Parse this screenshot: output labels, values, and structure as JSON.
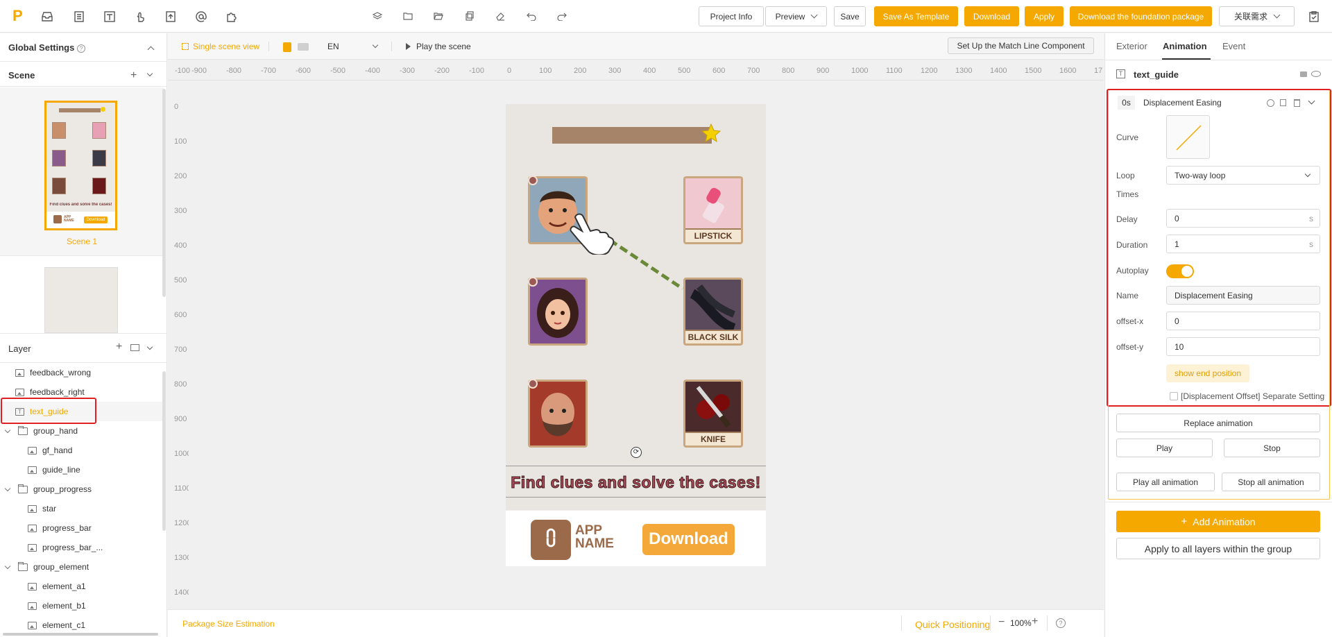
{
  "topbar": {
    "logo": "P",
    "project_info": "Project Info",
    "preview": "Preview",
    "save": "Save",
    "save_template": "Save As Template",
    "download": "Download",
    "apply": "Apply",
    "download_foundation": "Download the foundation package",
    "related": "关联需求"
  },
  "left": {
    "global_settings": "Global Settings",
    "scene_title": "Scene",
    "scene1_label": "Scene 1",
    "layer_title": "Layer",
    "layers": [
      {
        "label": "feedback_wrong"
      },
      {
        "label": "feedback_right"
      },
      {
        "label": "text_guide"
      },
      {
        "label": "group_hand"
      },
      {
        "label": "gf_hand"
      },
      {
        "label": "guide_line"
      },
      {
        "label": "group_progress"
      },
      {
        "label": "star"
      },
      {
        "label": "progress_bar"
      },
      {
        "label": "progress_bar_..."
      },
      {
        "label": "group_element"
      },
      {
        "label": "element_a1"
      },
      {
        "label": "element_b1"
      },
      {
        "label": "element_c1"
      }
    ]
  },
  "canvas": {
    "single_scene_view": "Single scene view",
    "lang": "EN",
    "play_scene": "Play the scene",
    "match_line_btn": "Set Up the Match Line Component",
    "h_ticks": [
      "-100",
      "-900",
      "-800",
      "-700",
      "-600",
      "-500",
      "-400",
      "-300",
      "-200",
      "-100",
      "0",
      "100",
      "200",
      "300",
      "400",
      "500",
      "600",
      "700",
      "800",
      "900",
      "1000",
      "1100",
      "1200",
      "1300",
      "1400",
      "1500",
      "1600",
      "17"
    ],
    "v_ticks": [
      "0",
      "100",
      "200",
      "300",
      "400",
      "500",
      "600",
      "700",
      "800",
      "900",
      "1000",
      "1100",
      "1200",
      "1300",
      "1400"
    ],
    "cards": {
      "lipstick": "LIPSTICK",
      "black_silk": "BLACK SILK",
      "knife": "KNIFE"
    },
    "guide_text": "Find clues and solve the cases!",
    "app_name_line1": "APP",
    "app_name_line2": "NAME",
    "download_cta": "Download",
    "thumb_text": "Find clues and solve the cases!",
    "thumb_app": "APP NAME",
    "thumb_dl": "Download"
  },
  "bottom": {
    "package_size": "Package Size Estimation",
    "quick_positioning": "Quick Positioning",
    "zoom": "100%"
  },
  "right": {
    "tabs": [
      "Exterior",
      "Animation",
      "Event"
    ],
    "layer_name": "text_guide",
    "anim_time": "0s",
    "anim_title": "Displacement Easing",
    "curve_label": "Curve",
    "loop_label": "Loop",
    "loop_value": "Two-way loop",
    "times_label": "Times",
    "delay_label": "Delay",
    "delay_value": "0",
    "delay_unit": "s",
    "duration_label": "Duration",
    "duration_value": "1",
    "duration_unit": "s",
    "autoplay_label": "Autoplay",
    "autoplay_on": true,
    "name_label": "Name",
    "name_value": "Displacement Easing",
    "offx_label": "offset-x",
    "offx_value": "0",
    "offy_label": "offset-y",
    "offy_value": "10",
    "show_end": "show end position",
    "separate_setting": "[Displacement Offset] Separate Setting",
    "replace": "Replace animation",
    "play": "Play",
    "stop": "Stop",
    "play_all": "Play all animation",
    "stop_all": "Stop all animation",
    "add_animation": "Add Animation",
    "apply_group": "Apply to all layers within the group"
  },
  "colors": {
    "accent": "#f5a800",
    "highlight": "#e02020"
  }
}
